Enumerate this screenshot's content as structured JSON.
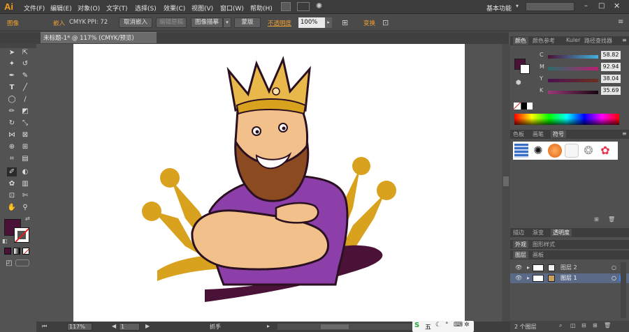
{
  "app": {
    "logo": "Ai",
    "workspace_label": "基本功能"
  },
  "menu": [
    "文件(F)",
    "编辑(E)",
    "对象(O)",
    "文字(T)",
    "选择(S)",
    "效果(C)",
    "视图(V)",
    "窗口(W)",
    "帮助(H)"
  ],
  "control": {
    "object_type": "图像",
    "embed": "嵌入",
    "color_mode": "CMYK",
    "ppi": "PPI: 72",
    "unembed_btn": "取消嵌入",
    "edit_original_btn": "编辑原稿",
    "image_trace_btn": "图像描摹",
    "mask_btn": "蒙版",
    "opacity_label": "不透明度",
    "opacity_value": "100%",
    "transform_label": "变换"
  },
  "document": {
    "tab_title": "未标题-1* @ 117% (CMYK/预览)"
  },
  "color_panel": {
    "tabs": [
      "颜色",
      "颜色参考",
      "Kuler",
      "路径查找器"
    ],
    "channels": [
      {
        "label": "C",
        "value": "58.82",
        "color": "#7ec9e6"
      },
      {
        "label": "M",
        "value": "92.94",
        "color": "#c2408f"
      },
      {
        "label": "Y",
        "value": "38.04",
        "color": "#e8d050"
      },
      {
        "label": "K",
        "value": "35.69",
        "color": "#444444"
      }
    ]
  },
  "swatch_panel": {
    "tabs": [
      "色板",
      "画笔",
      "符号"
    ]
  },
  "stroke_panel": {
    "tabs": [
      "描边",
      "渐变",
      "透明度"
    ]
  },
  "appearance_panel": {
    "tabs": [
      "外观",
      "图形样式"
    ]
  },
  "layers_panel": {
    "tabs": [
      "图层",
      "画板"
    ],
    "layers": [
      {
        "name": "图层 2"
      },
      {
        "name": "图层 1"
      }
    ],
    "footer": "2 个图层"
  },
  "status": {
    "zoom": "117%",
    "page": "1",
    "tool": "抓手"
  },
  "colors": {
    "fill": "#4a1236",
    "crown_gold": "#d9a21e",
    "shirt": "#8c3fa8",
    "plum": "#4a1236"
  }
}
